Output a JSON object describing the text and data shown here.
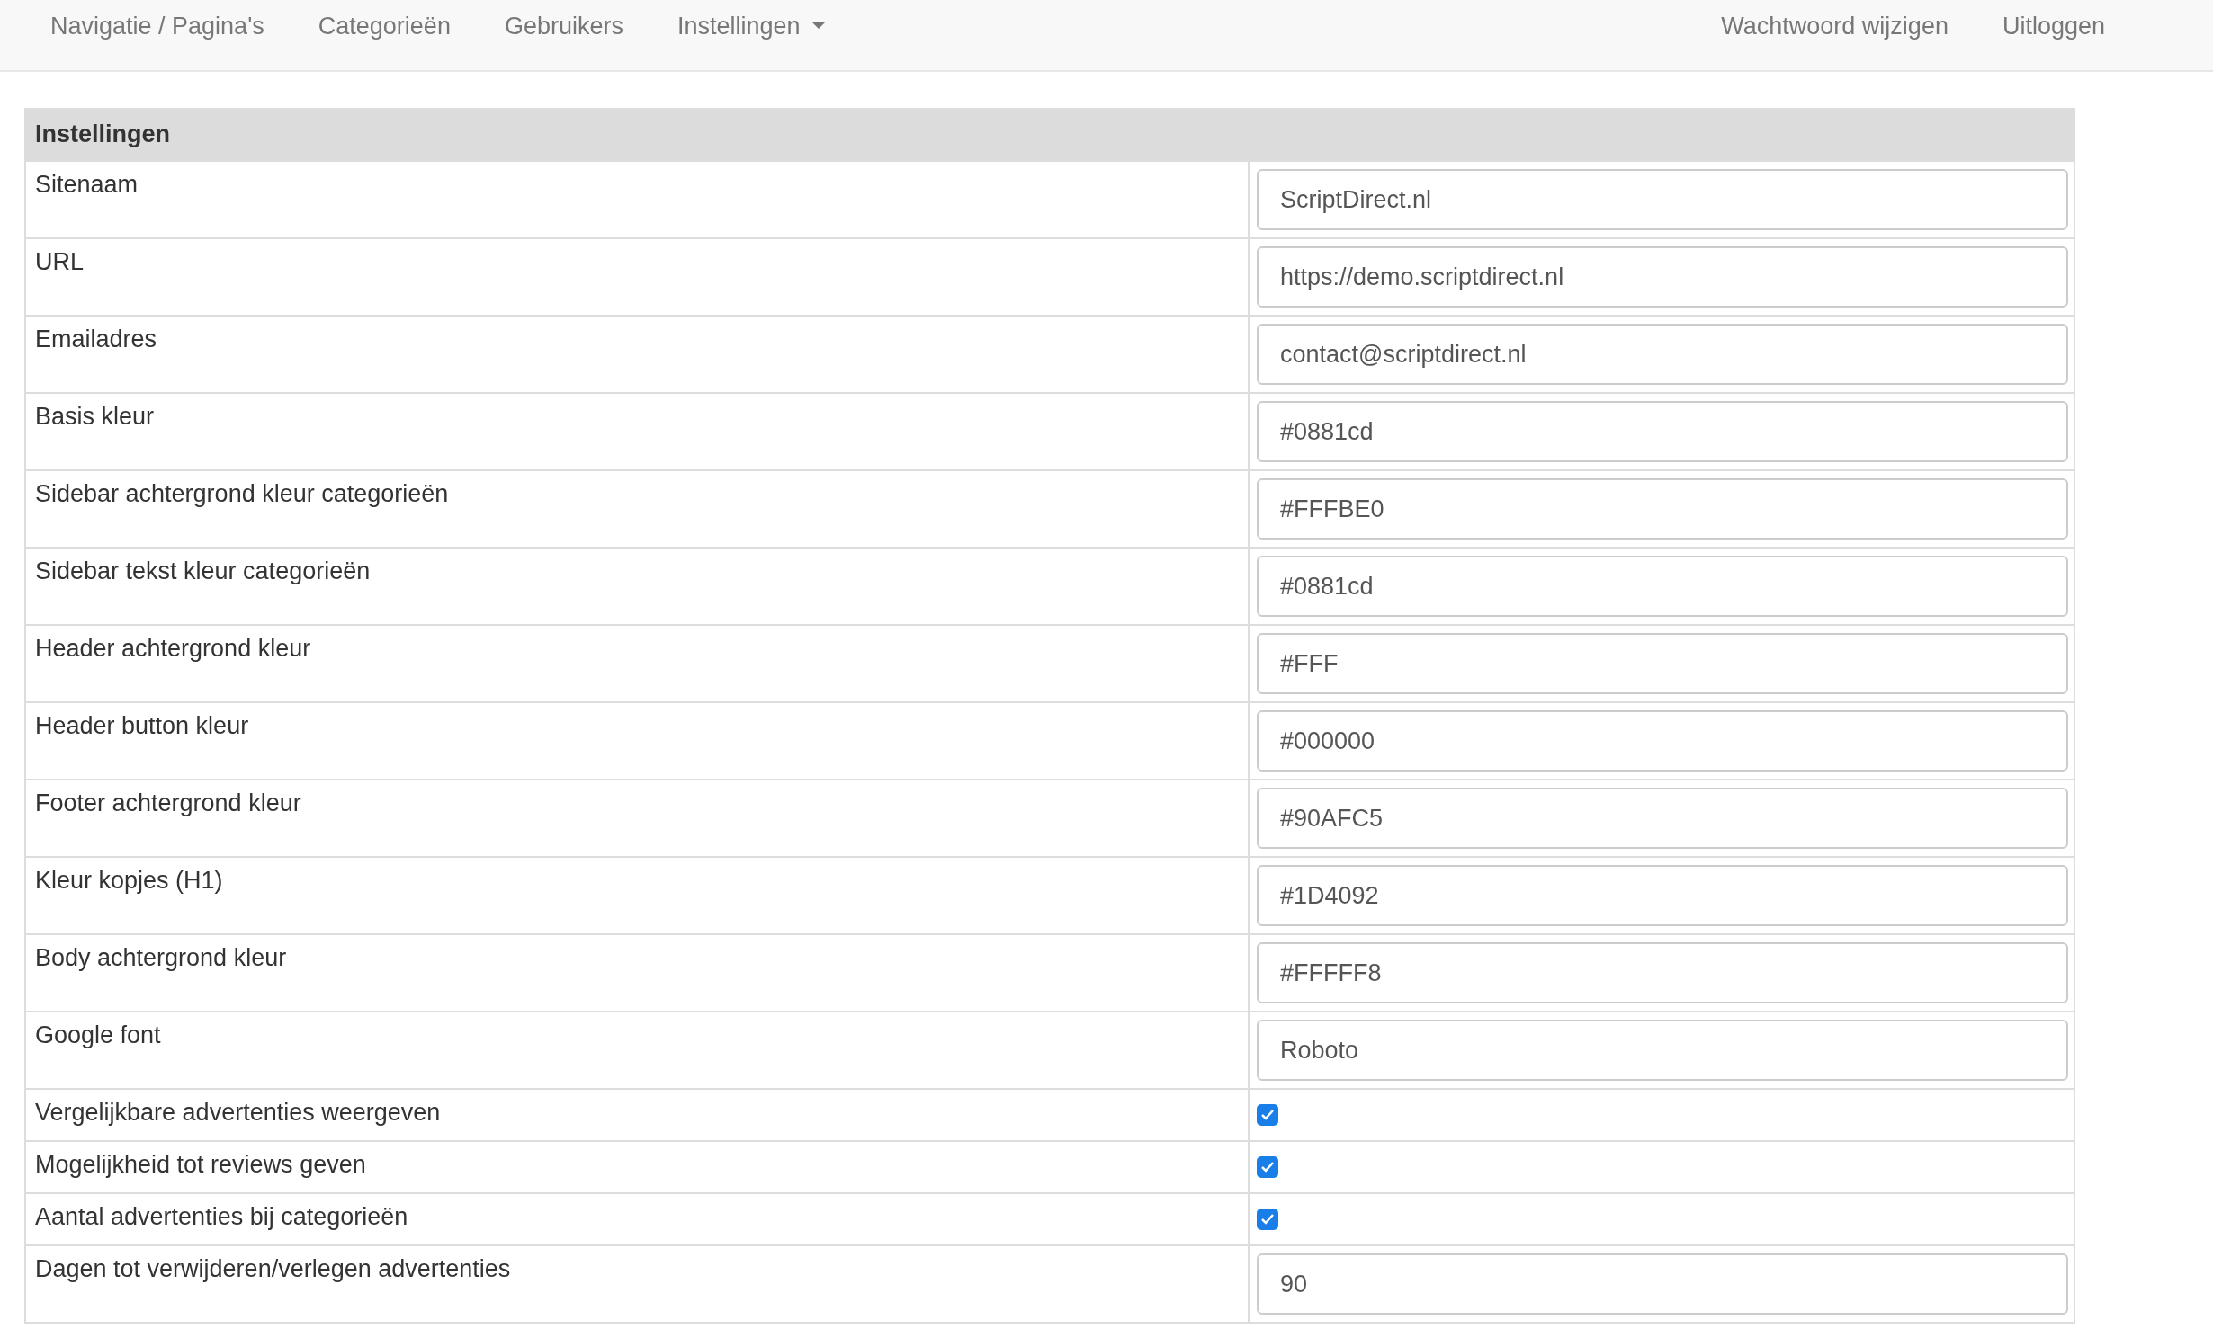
{
  "navbar": {
    "left": [
      {
        "label": "Navigatie / Pagina's",
        "dropdown": false
      },
      {
        "label": "Categorieën",
        "dropdown": false
      },
      {
        "label": "Gebruikers",
        "dropdown": false
      },
      {
        "label": "Instellingen",
        "dropdown": true
      }
    ],
    "right": [
      {
        "label": "Wachtwoord wijzigen"
      },
      {
        "label": "Uitloggen"
      }
    ]
  },
  "settings": {
    "title": "Instellingen",
    "rows": [
      {
        "kind": "text",
        "label": "Sitenaam",
        "value": "ScriptDirect.nl"
      },
      {
        "kind": "text",
        "label": "URL",
        "value": "https://demo.scriptdirect.nl"
      },
      {
        "kind": "text",
        "label": "Emailadres",
        "value": "contact@scriptdirect.nl"
      },
      {
        "kind": "text",
        "label": "Basis kleur",
        "value": "#0881cd"
      },
      {
        "kind": "text",
        "label": "Sidebar achtergrond kleur categorieën",
        "value": "#FFFBE0"
      },
      {
        "kind": "text",
        "label": "Sidebar tekst kleur categorieën",
        "value": "#0881cd"
      },
      {
        "kind": "text",
        "label": "Header achtergrond kleur",
        "value": "#FFF"
      },
      {
        "kind": "text",
        "label": "Header button kleur",
        "value": "#000000"
      },
      {
        "kind": "text",
        "label": "Footer achtergrond kleur",
        "value": "#90AFC5"
      },
      {
        "kind": "text",
        "label": "Kleur kopjes (H1)",
        "value": "#1D4092"
      },
      {
        "kind": "text",
        "label": "Body achtergrond kleur",
        "value": "#FFFFF8"
      },
      {
        "kind": "text",
        "label": "Google font",
        "value": "Roboto"
      },
      {
        "kind": "checkbox",
        "label": "Vergelijkbare advertenties weergeven",
        "checked": true
      },
      {
        "kind": "checkbox",
        "label": "Mogelijkheid tot reviews geven",
        "checked": true
      },
      {
        "kind": "checkbox",
        "label": "Aantal advertenties bij categorieën",
        "checked": true
      },
      {
        "kind": "text",
        "label": "Dagen tot verwijderen/verlegen advertenties",
        "value": "90"
      }
    ]
  }
}
